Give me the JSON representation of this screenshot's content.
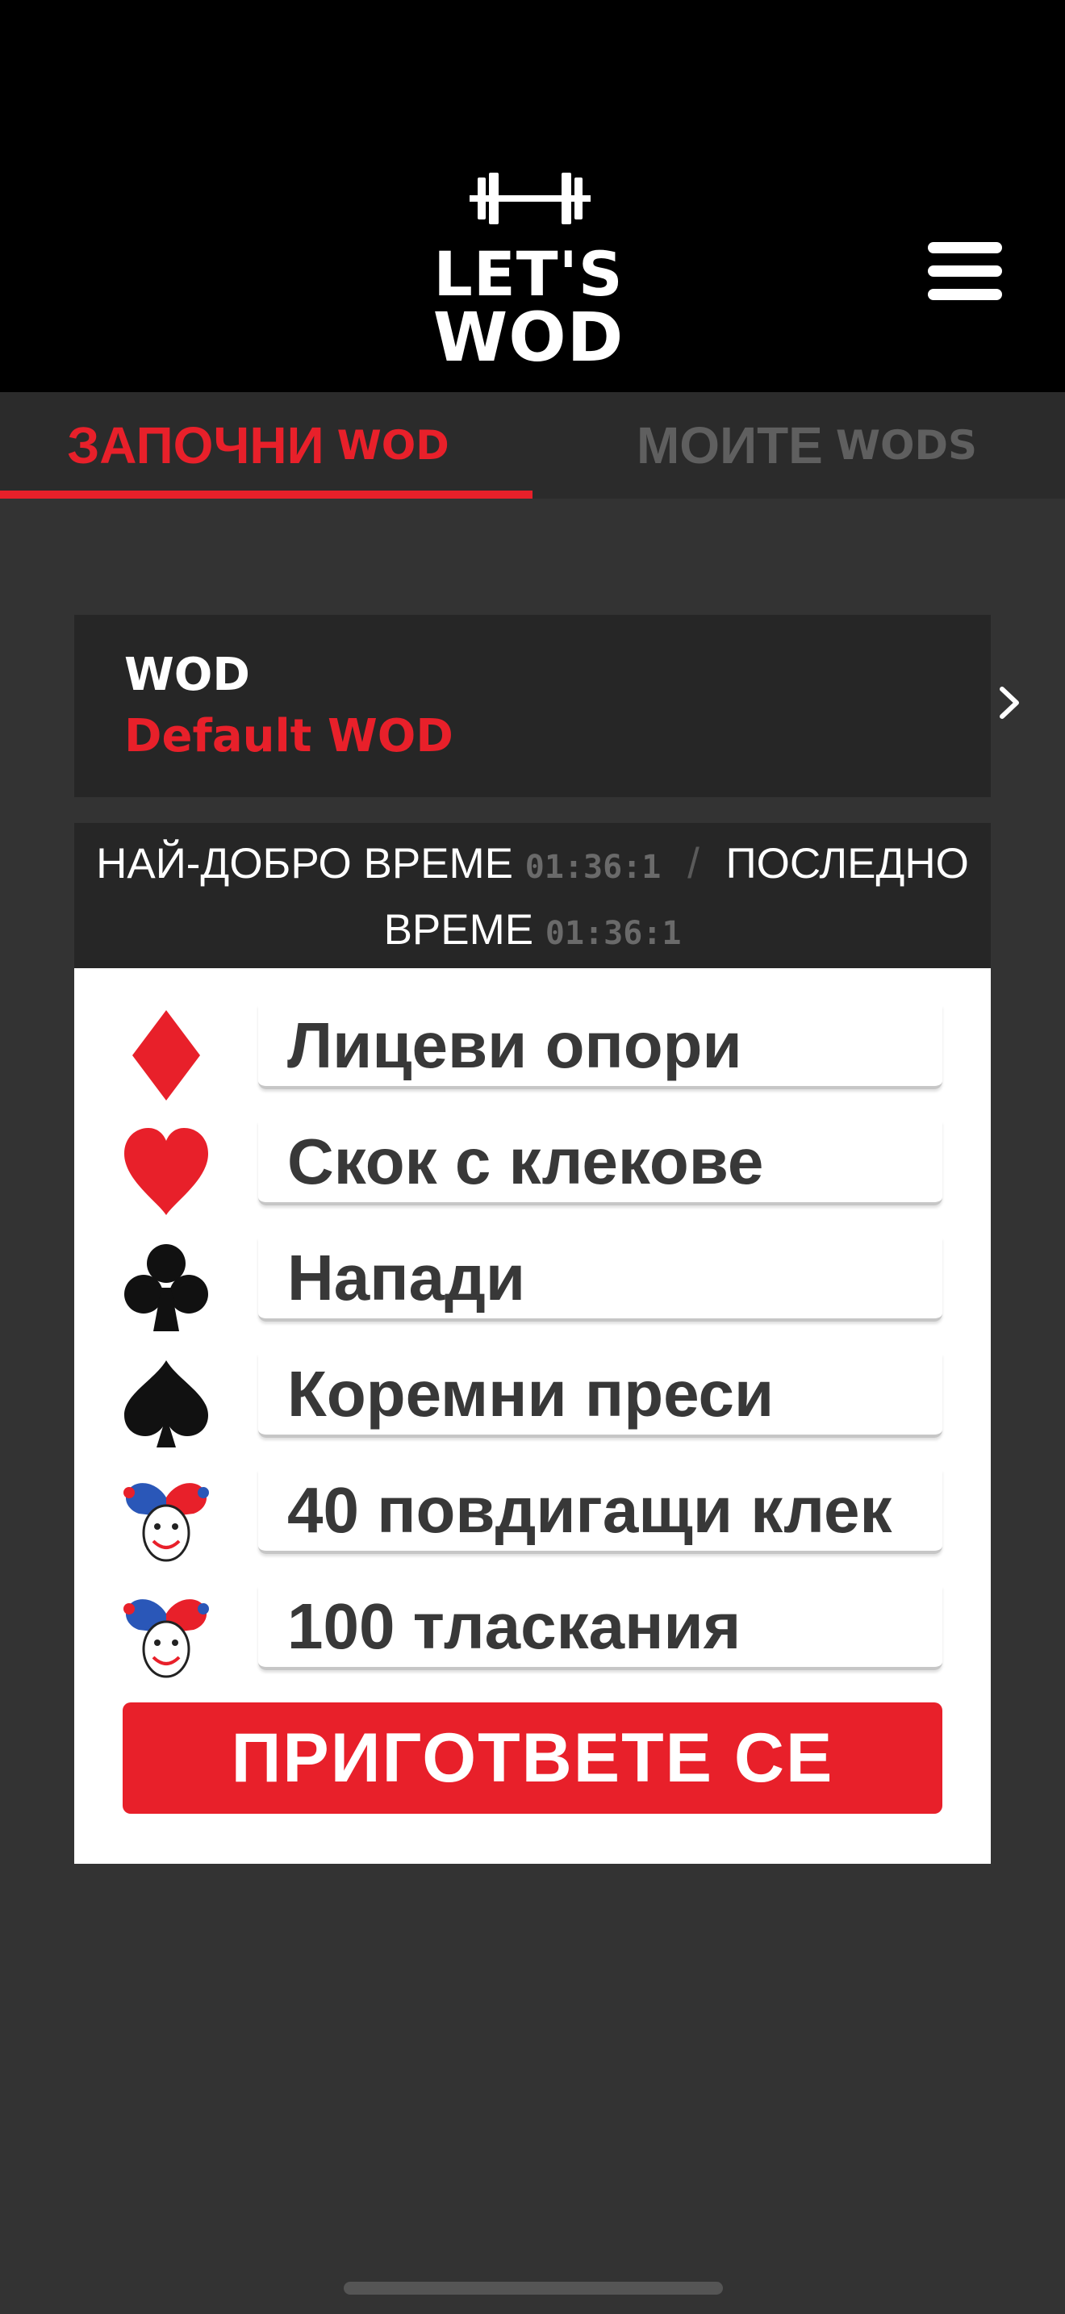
{
  "header": {
    "logo_line1": "LET'S",
    "logo_line2": "WOD",
    "menu_icon": "hamburger-menu-icon"
  },
  "tabs": [
    {
      "label": "ЗАПОЧНИ",
      "label_small": "WOD",
      "active": true
    },
    {
      "label": "МОИТЕ",
      "label_small": "WODS",
      "active": false
    }
  ],
  "wod_selector": {
    "label": "WOD",
    "name": "Default WOD",
    "icon": "chevron-right-icon"
  },
  "times": {
    "best_label": "НАЙ-ДОБРО ВРЕМЕ",
    "best_value": "01:36:1",
    "separator": "/",
    "last_label": "ПОСЛЕДНО ВРЕМЕ",
    "last_value": "01:36:1"
  },
  "exercises": [
    {
      "suit": "diamond-icon",
      "name": "Лицеви опори"
    },
    {
      "suit": "heart-icon",
      "name": "Скок с клекове"
    },
    {
      "suit": "club-icon",
      "name": "Напади"
    },
    {
      "suit": "spade-icon",
      "name": "Коремни преси"
    },
    {
      "suit": "joker-icon",
      "name": "40 повдигащи клек"
    },
    {
      "suit": "joker-icon",
      "name": "100 тласкания"
    }
  ],
  "ready_button": {
    "label": "ПРИГОТВЕТЕ СЕ"
  },
  "colors": {
    "accent": "#e8202a",
    "background": "#333333",
    "header": "#000000",
    "panel": "#262626"
  }
}
